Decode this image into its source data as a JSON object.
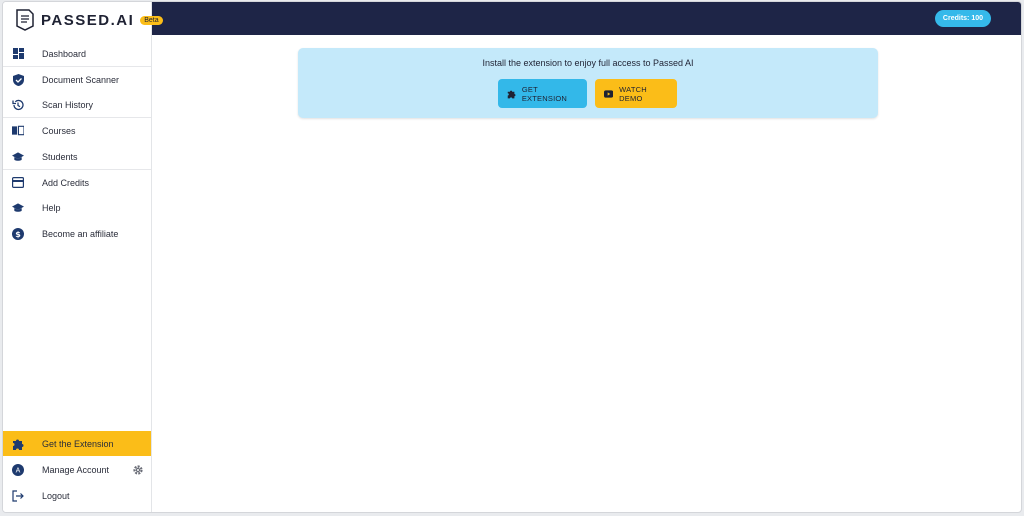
{
  "brand": {
    "name": "PASSED.AI",
    "badge": "Beta"
  },
  "header": {
    "credits": "Credits: 100"
  },
  "sidebar": {
    "items": [
      {
        "label": "Dashboard",
        "icon": "dashboard-icon"
      },
      {
        "label": "Document Scanner",
        "icon": "shield-check-icon"
      },
      {
        "label": "Scan History",
        "icon": "history-icon"
      },
      {
        "label": "Courses",
        "icon": "book-icon"
      },
      {
        "label": "Students",
        "icon": "graduation-cap-icon"
      },
      {
        "label": "Add Credits",
        "icon": "card-icon"
      },
      {
        "label": "Help",
        "icon": "graduation-cap-icon"
      },
      {
        "label": "Become an affiliate",
        "icon": "dollar-icon"
      }
    ],
    "bottom": [
      {
        "label": "Get the Extension",
        "icon": "puzzle-icon"
      },
      {
        "label": "Manage Account",
        "icon": "avatar-icon",
        "avatar_letter": "A"
      },
      {
        "label": "Logout",
        "icon": "logout-icon"
      }
    ]
  },
  "banner": {
    "text": "Install the extension to enjoy full access to Passed AI",
    "get_extension": "GET EXTENSION",
    "watch_demo": "WATCH DEMO"
  },
  "colors": {
    "navy": "#1e2547",
    "accent_yellow": "#fbbd18",
    "accent_blue": "#33b8e9",
    "banner_bg": "#c4e9fa"
  }
}
